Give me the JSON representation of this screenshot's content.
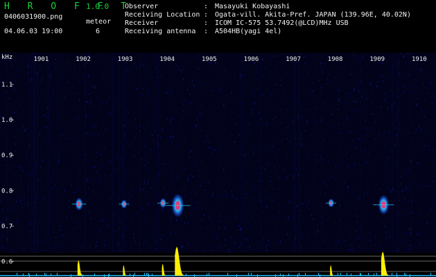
{
  "header": {
    "app_name": "H R O F F T",
    "version": "1.0.0",
    "filename": "0406031900.png",
    "meteor_label": "meteor",
    "datetime": "04.06.03 19:00",
    "meteor_count": "6",
    "info": [
      {
        "label": "Observer",
        "value": "Masayuki Kobayashi"
      },
      {
        "label": "Receiving Location",
        "value": "Ogata-vill. Akita-Pref. JAPAN (139.96E, 40.02N)"
      },
      {
        "label": "Receiver",
        "value": "ICOM IC-575 53.7492(@LCD)MHz USB"
      },
      {
        "label": "Receiving antenna",
        "value": "A504HB(yagi 4el)"
      }
    ],
    "separator": ":"
  },
  "plot": {
    "unit": "kHz",
    "y_ticks": [
      "1.1",
      "1.0",
      "0.9",
      "0.8",
      "0.7",
      "0.6"
    ],
    "x_ticks": [
      "1901",
      "1902",
      "1903",
      "1904",
      "1905",
      "1906",
      "1907",
      "1908",
      "1909",
      "1910"
    ],
    "colors": {
      "background": "#02021a",
      "noise": "#12147a",
      "echo_core": "#ff3a7a",
      "echo_halo": "#2fd0ff",
      "histogram": "#ffee00",
      "baseline": "#20c0ff",
      "gridline": "#cfcfcf"
    },
    "meteors": [
      {
        "minute": 1.75,
        "freq": 0.762,
        "strength": 0.45
      },
      {
        "minute": 2.82,
        "freq": 0.762,
        "strength": 0.25
      },
      {
        "minute": 3.75,
        "freq": 0.765,
        "strength": 0.3
      },
      {
        "minute": 4.1,
        "freq": 0.758,
        "strength": 1.0
      },
      {
        "minute": 7.75,
        "freq": 0.765,
        "strength": 0.25
      },
      {
        "minute": 9.0,
        "freq": 0.76,
        "strength": 0.8
      }
    ]
  }
}
